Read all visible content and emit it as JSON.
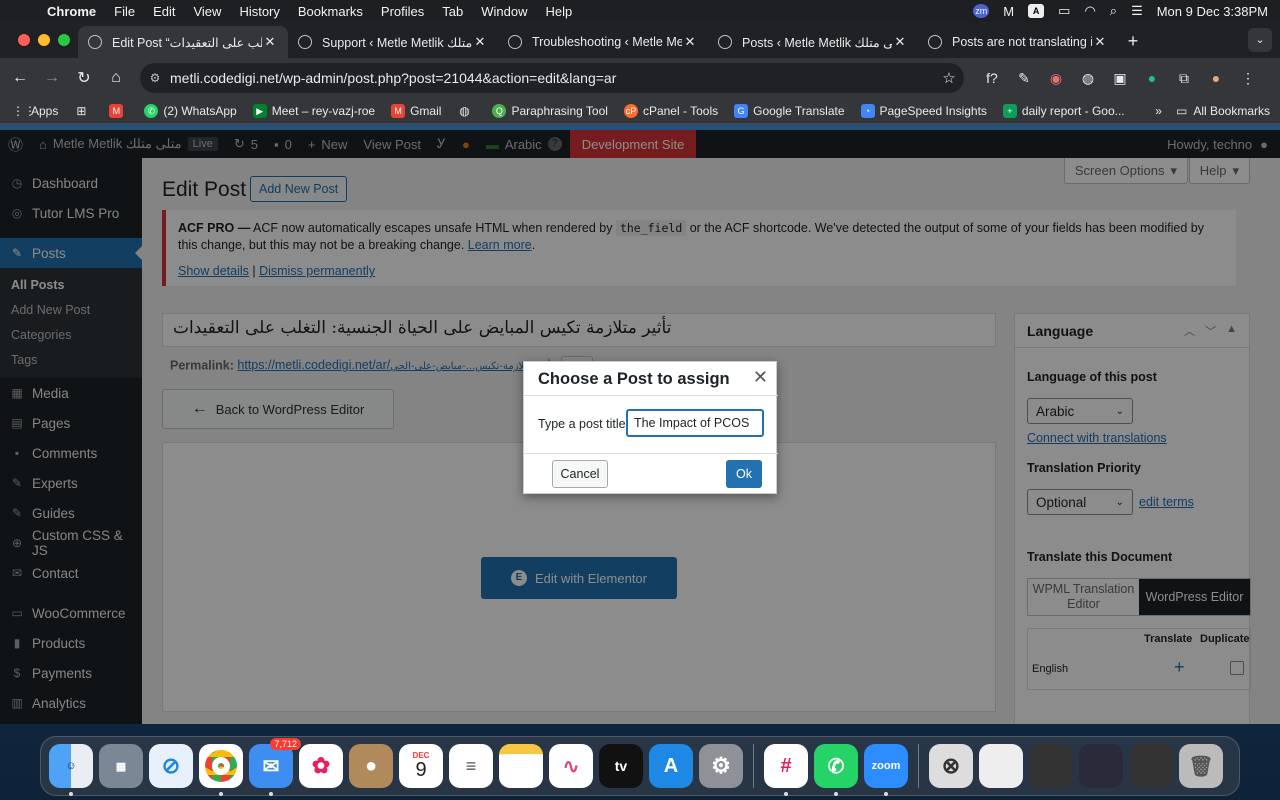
{
  "macbar": {
    "app": "Chrome",
    "menus": [
      "File",
      "Edit",
      "View",
      "History",
      "Bookmarks",
      "Profiles",
      "Tab",
      "Window",
      "Help"
    ],
    "clock": "Mon 9 Dec  3:38PM"
  },
  "tabs": [
    {
      "title": "Edit Post “تأثير متلازمة تكيس المبايض على الحياة الجنسية: التغلب على التعقيدات”"
    },
    {
      "title": "Support ‹ Metle Metlik متلى متلك"
    },
    {
      "title": "Troubleshooting ‹ Metle Metlik"
    },
    {
      "title": "Posts ‹ Metle Metlik متلى متلك —"
    },
    {
      "title": "Posts are not translating in th"
    }
  ],
  "toolbar": {
    "url": "metli.codedigi.net/wp-admin/post.php?post=21044&action=edit&lang=ar"
  },
  "bookmarks": {
    "items": [
      "Apps",
      "",
      "(2) WhatsApp",
      "Meet – rey-vazj-roe",
      "Gmail",
      "",
      "Paraphrasing Tool",
      "cPanel - Tools",
      "Google Translate",
      "PageSpeed Insights",
      "daily report - Goo..."
    ],
    "more": "»",
    "all": "All Bookmarks"
  },
  "adminbar": {
    "site": "Metle Metlik متلى متلك",
    "live": "Live",
    "updates": "5",
    "comments": "0",
    "new": "New",
    "view_post": "View Post",
    "language": "Arabic",
    "dev_site": "Development Site",
    "howdy": "Howdy, techno"
  },
  "sidebar": {
    "top": [
      "Dashboard",
      "Tutor LMS Pro"
    ],
    "posts": "Posts",
    "posts_sub": [
      "All Posts",
      "Add New Post",
      "Categories",
      "Tags"
    ],
    "rest": [
      "Media",
      "Pages",
      "Comments",
      "Experts",
      "Guides",
      "Custom CSS & JS",
      "Contact",
      "WooCommerce",
      "Products",
      "Payments",
      "Analytics"
    ]
  },
  "main": {
    "screen_options": "Screen Options",
    "help": "Help",
    "heading": "Edit Post",
    "add_new": "Add New Post",
    "notice_bold": "ACF PRO —",
    "notice_t1": " ACF now automatically escapes unsafe HTML when rendered by ",
    "notice_code": "the_field",
    "notice_t2": " or the ACF shortcode. We've detected the output of some of your fields has been modified by this change, but this may not be a breaking change. ",
    "notice_learn": "Learn more",
    "notice_details": "Show details",
    "notice_sep": " | ",
    "notice_dismiss": "Dismiss permanently",
    "post_title": "تأثير متلازمة تكيس المبايض على الحياة الجنسية: التغلب على التعقيدات",
    "permalink_label": "Permalink:",
    "permalink_url": "https://metli.codedigi.net/ar/",
    "permalink_slug": "تأثير-متلازمة-تكيس...-مبايض-على-الحي",
    "back_btn": "Back to WordPress Editor",
    "elementor_btn": "Edit with Elementor"
  },
  "language_box": {
    "title": "Language",
    "lang_label": "Language of this post",
    "lang_value": "Arabic",
    "connect": "Connect with translations",
    "priority_label": "Translation Priority",
    "priority_value": "Optional",
    "edit_terms": "edit terms",
    "translate_label": "Translate this Document",
    "seg_wpml": "WPML Translation Editor",
    "seg_wp": "WordPress Editor",
    "col_translate": "Translate",
    "col_duplicate": "Duplicate",
    "row_lang": "English"
  },
  "dialog": {
    "title": "Choose a Post to assign",
    "prompt": "Type a post title:",
    "input_value": "The Impact of PCOS",
    "cancel": "Cancel",
    "ok": "Ok"
  },
  "dock": {
    "mail_badge": "7,712",
    "calendar_month": "DEC",
    "calendar_day": "9",
    "tv_label": "tv",
    "zoom_label": "zoom"
  },
  "colors": {
    "wp_blue": "#2271b1",
    "wp_dark": "#1d2327",
    "notice_red": "#d63638"
  }
}
